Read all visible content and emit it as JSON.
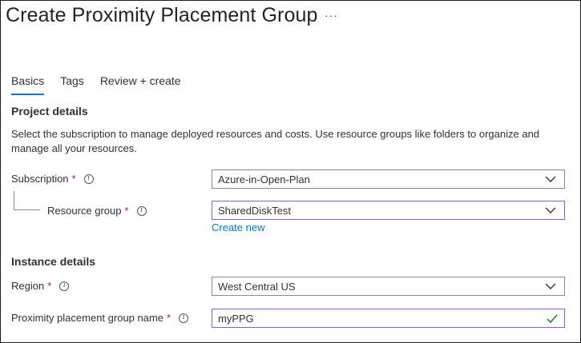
{
  "header": {
    "title": "Create Proximity Placement Group",
    "more_label": "···"
  },
  "tabs": [
    {
      "label": "Basics"
    },
    {
      "label": "Tags"
    },
    {
      "label": "Review + create"
    }
  ],
  "project_details": {
    "title": "Project details",
    "description": "Select the subscription to manage deployed resources and costs. Use resource groups like folders to organize and manage all your resources.",
    "subscription": {
      "label": "Subscription",
      "value": "Azure-in-Open-Plan"
    },
    "resource_group": {
      "label": "Resource group",
      "value": "SharedDiskTest",
      "create_new": "Create new"
    }
  },
  "instance_details": {
    "title": "Instance details",
    "region": {
      "label": "Region",
      "value": "West Central US"
    },
    "ppg_name": {
      "label": "Proximity placement group name",
      "value": "myPPG"
    }
  },
  "required_marker": "*",
  "info_glyph": "i",
  "colors": {
    "accent": "#0078d4",
    "focus_border": "#8661c5",
    "required": "#a4262c",
    "valid": "#107c10"
  }
}
